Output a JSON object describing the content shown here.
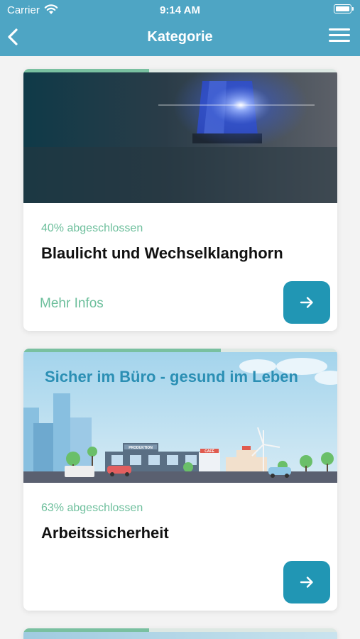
{
  "status_bar": {
    "carrier": "Carrier",
    "time": "9:14 AM"
  },
  "nav": {
    "title": "Kategorie"
  },
  "cards": [
    {
      "progress_percent": 40,
      "progress_label": "40% abgeschlossen",
      "title": "Blaulicht und Wechselklanghorn",
      "more_label": "Mehr Infos"
    },
    {
      "progress_percent": 63,
      "progress_label": "63% abgeschlossen",
      "title": "Arbeitssicherheit",
      "banner_text": "Sicher im Büro - gesund im Leben",
      "sign_production": "PRODUKTION",
      "sign_cafe": "CAFÉ"
    },
    {
      "progress_percent": 40
    }
  ],
  "colors": {
    "header": "#4ea5c4",
    "accent_green": "#6dbf9c",
    "button": "#2196b4"
  },
  "icons": [
    "wifi-icon",
    "battery-icon",
    "back-chevron-icon",
    "hamburger-menu-icon",
    "arrow-right-icon"
  ]
}
